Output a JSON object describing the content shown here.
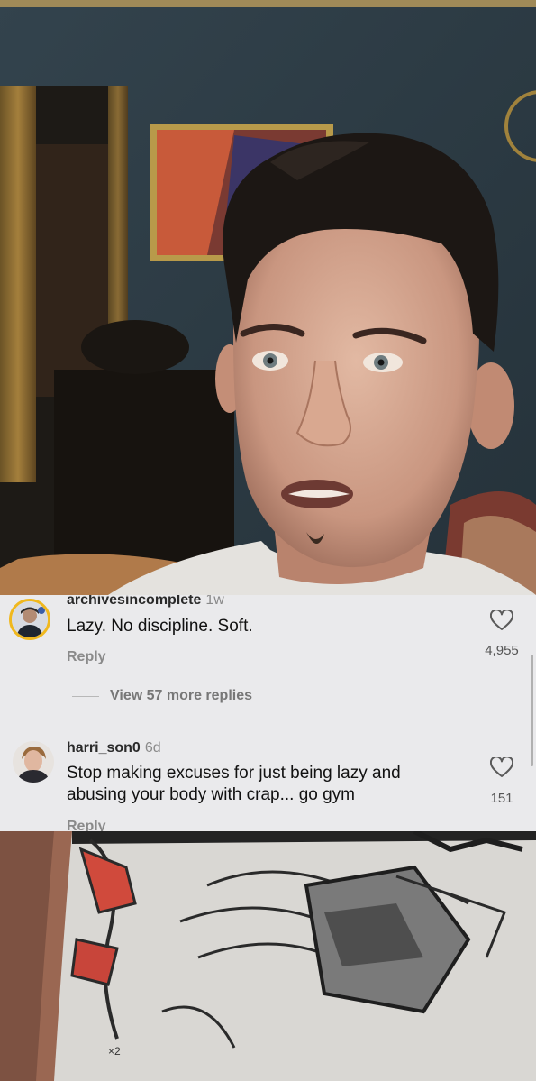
{
  "comments": [
    {
      "username": "archivesincomplete",
      "age": "1w",
      "text": "Lazy. No discipline. Soft.",
      "reply_label": "Reply",
      "likes": "4,955",
      "view_replies_label": "View 57 more replies"
    },
    {
      "username": "harri_son0",
      "age": "6d",
      "text": "Stop making excuses for just being lazy and abusing your body with crap... go gym",
      "reply_label": "Reply",
      "likes": "151"
    }
  ],
  "colors": {
    "panel_background": "#eaeaec",
    "username": "#2a2a2a",
    "secondary_text": "#8a8a8a",
    "wall": "#2c3a43"
  },
  "icons": {
    "like": "heart-outline-icon"
  }
}
